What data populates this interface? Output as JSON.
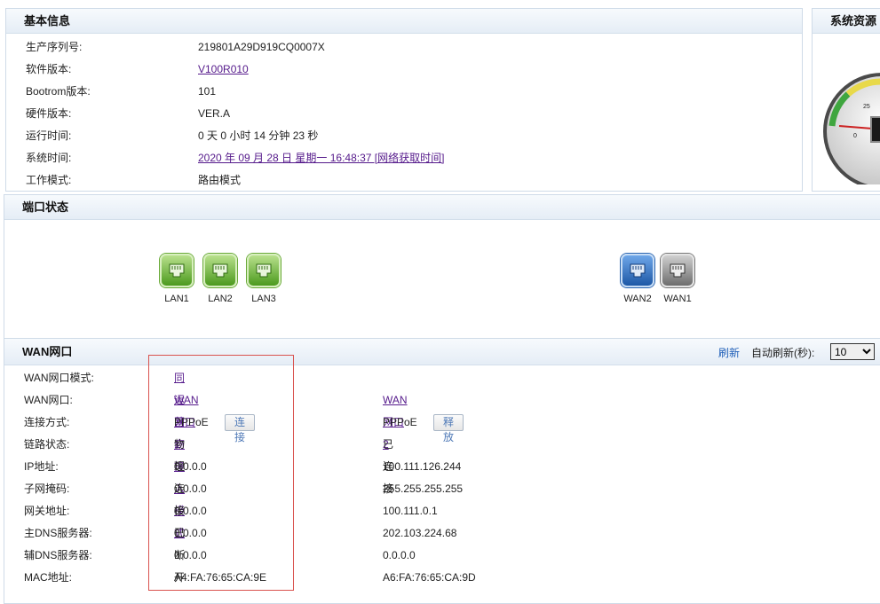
{
  "basic": {
    "title": "基本信息",
    "rows": [
      {
        "label": "生产序列号:",
        "value": "219801A29D919CQ0007X"
      },
      {
        "label": "软件版本:",
        "value": "V100R010"
      },
      {
        "label": "Bootrom版本:",
        "value": "101"
      },
      {
        "label": "硬件版本:",
        "value": "VER.A"
      },
      {
        "label": "运行时间:",
        "value": "0 天 0 小时 14 分钟 23 秒"
      },
      {
        "label": "系统时间:",
        "value": "2020 年 09 月 28 日 星期一 16:48:37  [网络获取时间]"
      },
      {
        "label": "工作模式:",
        "value": "路由模式"
      }
    ]
  },
  "resources": {
    "title": "系统资源",
    "gauge_ticks": [
      "0",
      "25"
    ]
  },
  "ports": {
    "title": "端口状态",
    "items": [
      {
        "name": "LAN1",
        "color": "green"
      },
      {
        "name": "LAN2",
        "color": "green"
      },
      {
        "name": "LAN3",
        "color": "green"
      },
      {
        "name": "WAN2",
        "color": "blue"
      },
      {
        "name": "WAN1",
        "color": "gray"
      }
    ]
  },
  "wan": {
    "title": "WAN网口",
    "refresh": "刷新",
    "auto_refresh_label": "自动刷新(秒):",
    "auto_refresh_value": "10",
    "rows": [
      {
        "label": "WAN网口模式:",
        "v1": "同运营商接入模式",
        "v2": ""
      },
      {
        "label": "WAN网口:",
        "v1": "WAN网口1",
        "v2": "WAN网口2"
      },
      {
        "label": "连接方式:",
        "v1": "PPPoE",
        "v2": "PPPoE"
      },
      {
        "label": "链路状态:",
        "v1": "物理连接已断开",
        "v2": "已连接"
      },
      {
        "label": "IP地址:",
        "v1": "0.0.0.0",
        "v2": "100.111.126.244"
      },
      {
        "label": "子网掩码:",
        "v1": "0.0.0.0",
        "v2": "255.255.255.255"
      },
      {
        "label": "网关地址:",
        "v1": "0.0.0.0",
        "v2": "100.111.0.1"
      },
      {
        "label": "主DNS服务器:",
        "v1": "0.0.0.0",
        "v2": "202.103.224.68"
      },
      {
        "label": "辅DNS服务器:",
        "v1": "0.0.0.0",
        "v2": "0.0.0.0"
      },
      {
        "label": "MAC地址:",
        "v1": "A4:FA:76:65:CA:9E",
        "v2": "A6:FA:76:65:CA:9D"
      }
    ],
    "btn_connect": "连接",
    "btn_release": "释放"
  },
  "colors": {
    "highlight_box": "#d9534f",
    "link": "#551a8b",
    "refresh": "#1f5fb8"
  }
}
